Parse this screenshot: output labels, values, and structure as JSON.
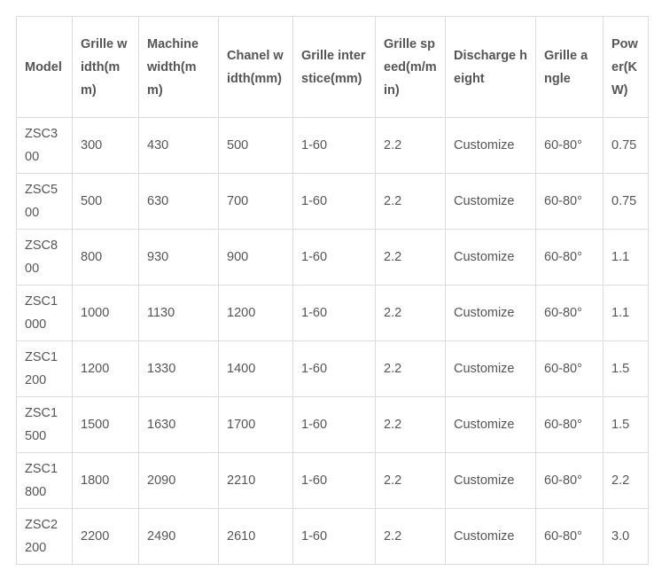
{
  "table": {
    "headers": [
      "Model",
      "Grille width(mm)",
      "Machine width(mm)",
      "Chanel width(mm)",
      "Grille interstice(mm)",
      "Grille speed(m/min)",
      "Discharge height",
      "Grille angle",
      "Power(KW)"
    ],
    "rows": [
      [
        "ZSC300",
        "300",
        "430",
        "500",
        "1-60",
        "2.2",
        "Customize",
        "60-80°",
        "0.75"
      ],
      [
        "ZSC500",
        "500",
        "630",
        "700",
        "1-60",
        "2.2",
        "Customize",
        "60-80°",
        "0.75"
      ],
      [
        "ZSC800",
        "800",
        "930",
        "900",
        "1-60",
        "2.2",
        "Customize",
        "60-80°",
        "1.1"
      ],
      [
        "ZSC1000",
        "1000",
        "1130",
        "1200",
        "1-60",
        "2.2",
        "Customize",
        "60-80°",
        "1.1"
      ],
      [
        "ZSC1200",
        "1200",
        "1330",
        "1400",
        "1-60",
        "2.2",
        "Customize",
        "60-80°",
        "1.5"
      ],
      [
        "ZSC1500",
        "1500",
        "1630",
        "1700",
        "1-60",
        "2.2",
        "Customize",
        "60-80°",
        "1.5"
      ],
      [
        "ZSC1800",
        "1800",
        "2090",
        "2210",
        "1-60",
        "2.2",
        "Customize",
        "60-80°",
        "2.2"
      ],
      [
        "ZSC2200",
        "2200",
        "2490",
        "2610",
        "1-60",
        "2.2",
        "Customize",
        "60-80°",
        "3.0"
      ]
    ]
  }
}
